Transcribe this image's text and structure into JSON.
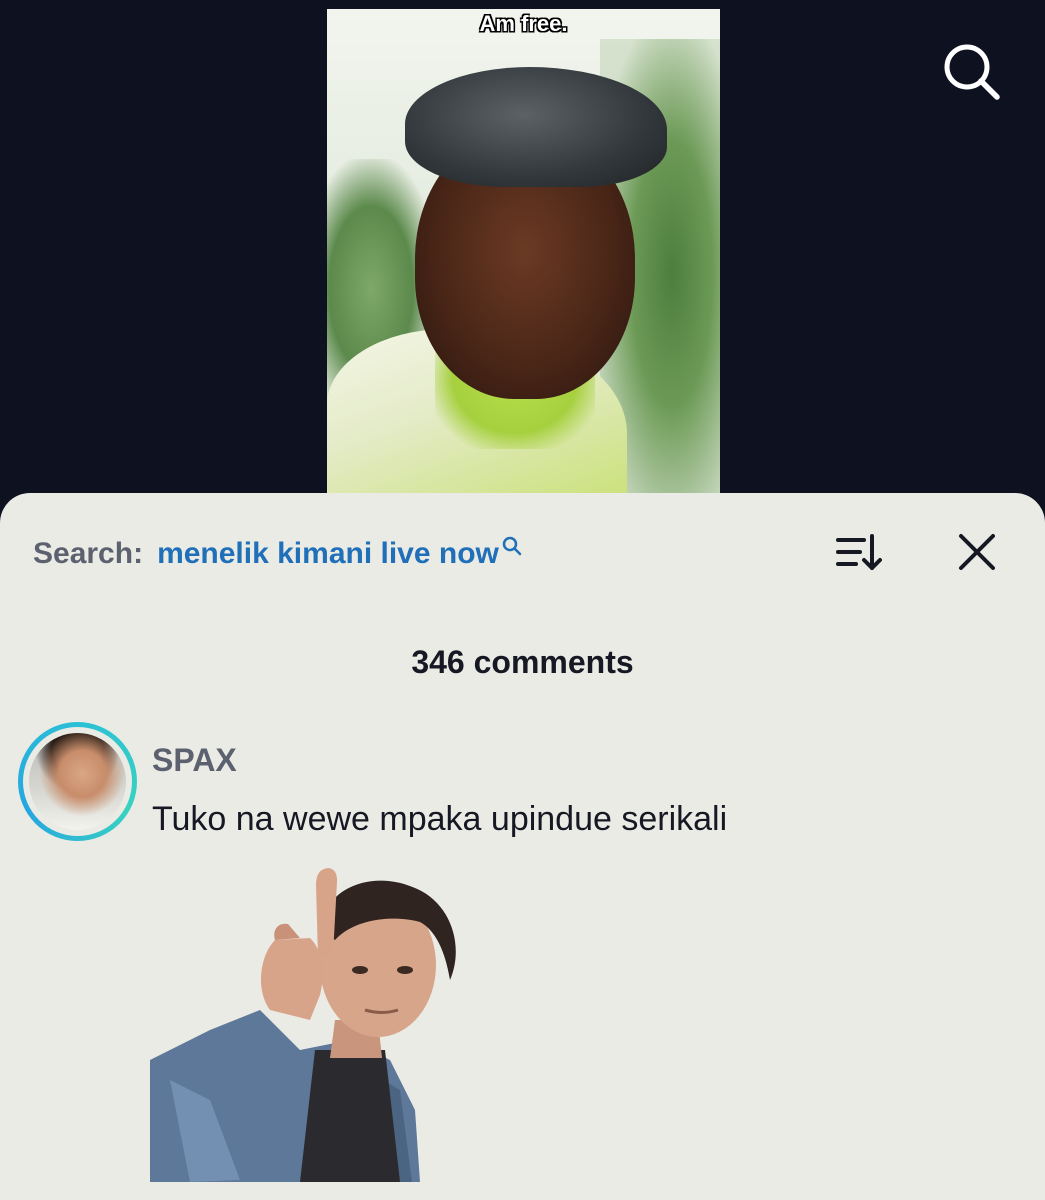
{
  "video": {
    "caption": "Am free."
  },
  "top_bar": {
    "search_icon": "search-icon"
  },
  "sheet": {
    "search_label": "Search:",
    "search_query": "menelik kimani live now",
    "sort_icon": "sort-icon",
    "close_icon": "close-icon",
    "comments_count": "346 comments"
  },
  "comment": {
    "username": "SPAX",
    "text": "Tuko na wewe mpaka upindue serikali",
    "sticker": "sticker-image"
  },
  "colors": {
    "background": "#0d1120",
    "sheet": "#ebebe5",
    "search_link": "#1f6fb9",
    "avatar_ring": "#2bc0d6"
  }
}
